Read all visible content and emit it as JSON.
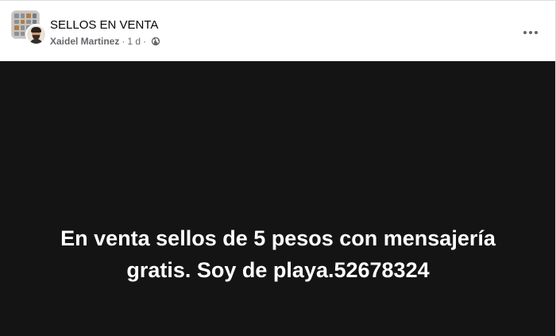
{
  "header": {
    "group_name": "SELLOS EN VENTA",
    "author": "Xaidel Martinez",
    "separator": "·",
    "time": "1 d",
    "time_separator": "·"
  },
  "icons": {
    "more": "more-horizontal-icon",
    "audience": "globe-icon"
  },
  "post": {
    "text": "En venta sellos de 5 pesos con mensajería gratis. Soy de playa.52678324",
    "background_color": "#141414",
    "text_color": "#ffffff"
  }
}
